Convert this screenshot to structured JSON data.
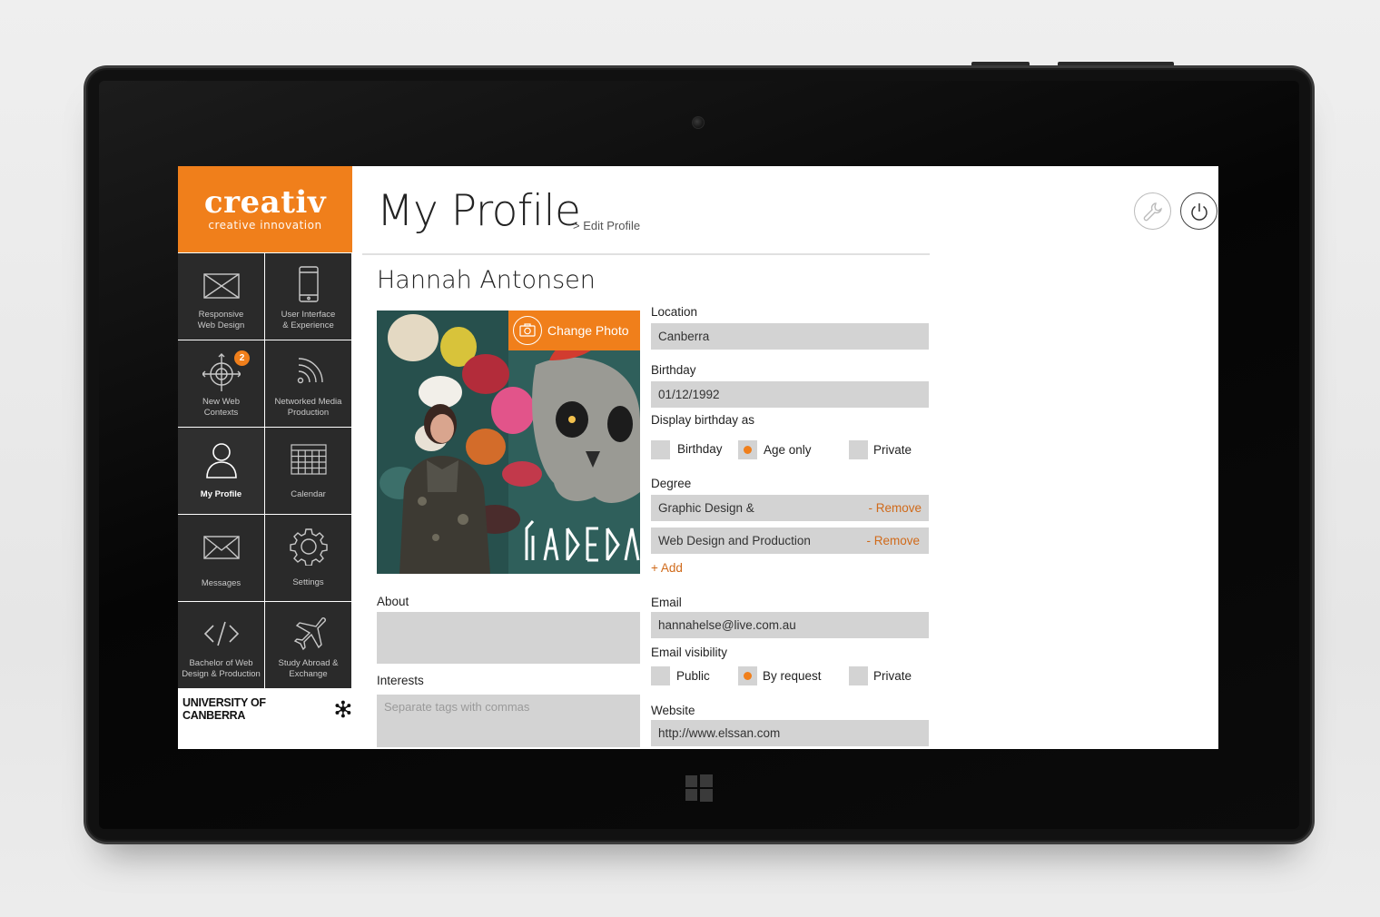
{
  "app": {
    "brand_name": "creativ",
    "brand_tagline": "creative innovation",
    "university": "UNIVERSITY OF CANBERRA"
  },
  "colors": {
    "accent": "#f07f1b",
    "sidebar_tile": "#2a2a2a",
    "field": "#d3d3d3"
  },
  "sidebar": {
    "tiles": [
      {
        "label": "Responsive\nWeb Design",
        "icon": "wireframe-icon"
      },
      {
        "label": "User Interface\n& Experience",
        "icon": "phone-icon"
      },
      {
        "label": "New Web\nContexts",
        "icon": "crosshair-icon",
        "badge": "2"
      },
      {
        "label": "Networked Media\nProduction",
        "icon": "rss-icon"
      },
      {
        "label": "My Profile",
        "icon": "user-icon",
        "active": true
      },
      {
        "label": "Calendar",
        "icon": "calendar-icon"
      },
      {
        "label": "Messages",
        "icon": "envelope-icon"
      },
      {
        "label": "Settings",
        "icon": "gear-icon"
      },
      {
        "label": "Bachelor of Web\nDesign & Production",
        "icon": "code-icon"
      },
      {
        "label": "Study Abroad &\nExchange",
        "icon": "airplane-icon"
      }
    ]
  },
  "header": {
    "title": "My Profile",
    "breadcrumb": "> Edit Profile",
    "tools_icon": "wrench-icon",
    "power_icon": "power-icon"
  },
  "profile": {
    "name": "Hannah Antonsen",
    "change_photo_label": "Change Photo",
    "about_label": "About",
    "about_value": "",
    "interests_label": "Interests",
    "interests_placeholder": "Separate tags with commas",
    "location_label": "Location",
    "location_value": "Canberra",
    "birthday_label": "Birthday",
    "birthday_value": "01/12/1992",
    "display_birthday_label": "Display birthday as",
    "birthday_options": [
      {
        "label": "Birthday",
        "checked": false
      },
      {
        "label": "Age only",
        "checked": true
      },
      {
        "label": "Private",
        "checked": false
      }
    ],
    "degree_label": "Degree",
    "degrees": [
      {
        "name": "Graphic Design &",
        "remove": "- Remove"
      },
      {
        "name": "Web Design and Production",
        "remove": "- Remove"
      }
    ],
    "add_label": "+ Add",
    "email_label": "Email",
    "email_value": "hannahelse@live.com.au",
    "email_visibility_label": "Email visibility",
    "email_options": [
      {
        "label": "Public",
        "checked": false
      },
      {
        "label": "By request",
        "checked": true
      },
      {
        "label": "Private",
        "checked": false
      }
    ],
    "website_label": "Website",
    "website_value": "http://www.elssan.com"
  }
}
